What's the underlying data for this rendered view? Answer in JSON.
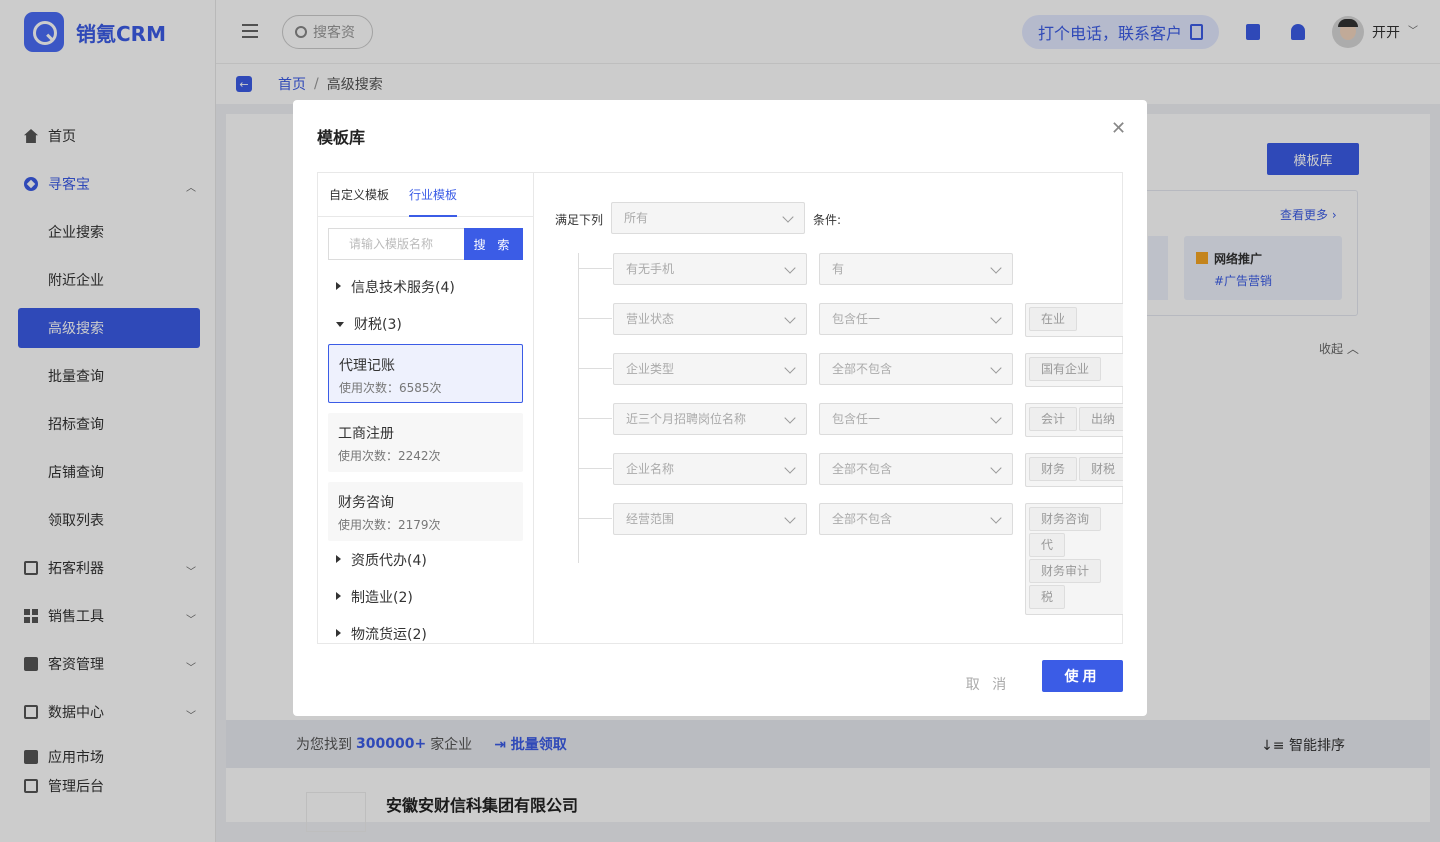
{
  "app": {
    "name": "销氪CRM"
  },
  "sidebar": {
    "items": [
      {
        "label": "首页",
        "icon": "home-icon"
      },
      {
        "label": "寻客宝",
        "icon": "compass-icon",
        "expanded": true,
        "children": [
          {
            "label": "企业搜索"
          },
          {
            "label": "附近企业"
          },
          {
            "label": "高级搜索",
            "active": true
          },
          {
            "label": "批量查询"
          },
          {
            "label": "招标查询"
          },
          {
            "label": "店铺查询"
          },
          {
            "label": "领取列表"
          }
        ]
      },
      {
        "label": "拓客利器",
        "icon": "id-card-icon"
      },
      {
        "label": "销售工具",
        "icon": "grid-icon"
      },
      {
        "label": "客资管理",
        "icon": "crm-icon"
      },
      {
        "label": "数据中心",
        "icon": "chart-icon"
      },
      {
        "label": "应用市场",
        "icon": "mail-icon"
      },
      {
        "label": "管理后台",
        "icon": "monitor-icon"
      }
    ]
  },
  "header": {
    "search_placeholder": "搜客资",
    "call_label": "打个电话，联系客户",
    "user_name": "开开"
  },
  "breadcrumb": {
    "home": "首页",
    "sep": "/",
    "current": "高级搜索"
  },
  "background": {
    "template_button": "模板库",
    "see_more": "查看更多",
    "rec_title": "网络推广",
    "rec_tag": "#广告营销",
    "collapse": "收起",
    "result_prefix": "为您找到",
    "result_count": "300000+",
    "result_suffix": "家企业",
    "batch_claim": "批量领取",
    "smart_sort": "智能排序",
    "first_company": "安徽安财信科集团有限公司"
  },
  "modal": {
    "title": "模板库",
    "tabs": [
      {
        "label": "自定义模板"
      },
      {
        "label": "行业模板",
        "active": true
      }
    ],
    "search_placeholder": "请输入模版名称",
    "search_button": "搜 索",
    "categories": [
      {
        "label": "信息技术服务(4)",
        "expanded": false
      },
      {
        "label": "财税(3)",
        "expanded": true
      },
      {
        "label": "资质代办(4)",
        "expanded": false
      },
      {
        "label": "制造业(2)",
        "expanded": false
      },
      {
        "label": "物流货运(2)",
        "expanded": false
      }
    ],
    "templates": [
      {
        "name": "代理记账",
        "usage": "使用次数：6585次",
        "selected": true
      },
      {
        "name": "工商注册",
        "usage": "使用次数：2242次"
      },
      {
        "name": "财务咨询",
        "usage": "使用次数：2179次"
      }
    ],
    "condition": {
      "prefix": "满足下列",
      "mode": "所有",
      "suffix": "条件:"
    },
    "rules": [
      {
        "field": "有无手机",
        "op": "有",
        "tags": []
      },
      {
        "field": "营业状态",
        "op": "包含任一",
        "tags": [
          "在业"
        ]
      },
      {
        "field": "企业类型",
        "op": "全部不包含",
        "tags": [
          "国有企业"
        ]
      },
      {
        "field": "近三个月招聘岗位名称",
        "op": "包含任一",
        "tags": [
          "会计",
          "出纳"
        ]
      },
      {
        "field": "企业名称",
        "op": "全部不包含",
        "tags": [
          "财务",
          "财税"
        ]
      },
      {
        "field": "经营范围",
        "op": "全部不包含",
        "tags": [
          "财务咨询",
          "代",
          "财务审计",
          "税"
        ]
      }
    ],
    "cancel": "取 消",
    "use": "使用"
  },
  "colors": {
    "accent": "#3b5ce6",
    "accent_light": "#e3e9ff"
  }
}
